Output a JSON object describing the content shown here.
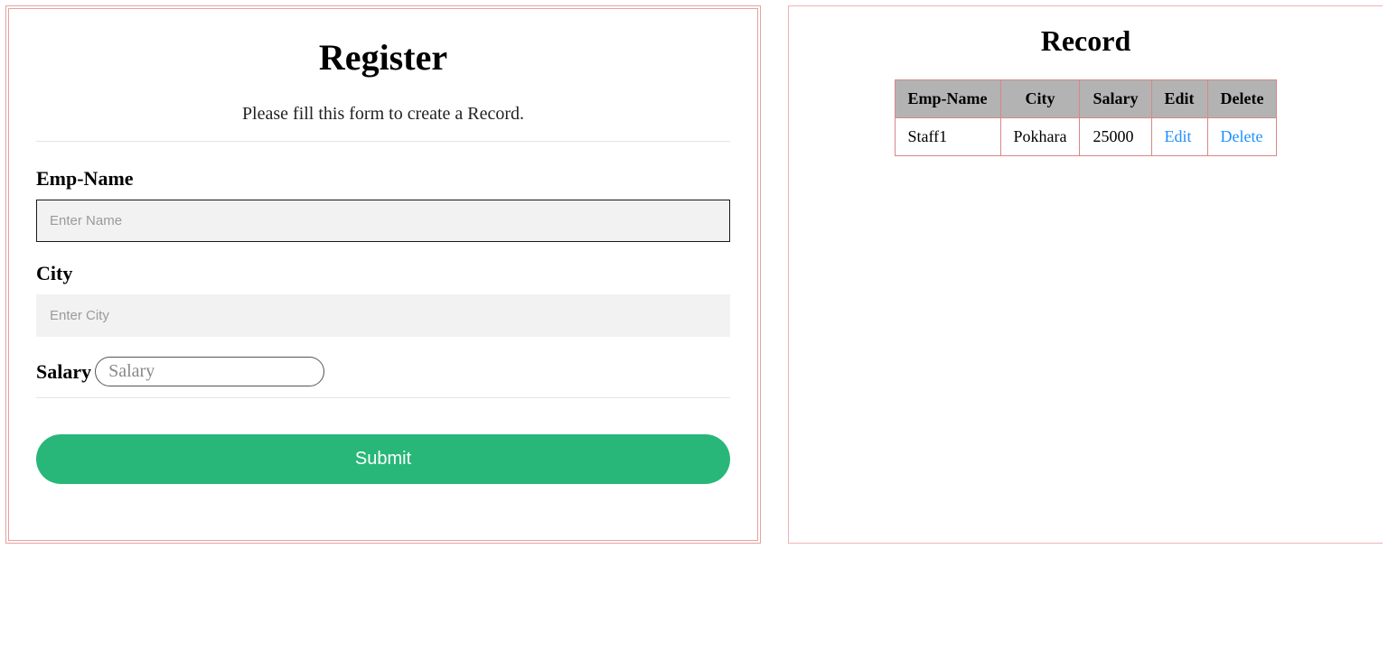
{
  "register": {
    "title": "Register",
    "subtitle": "Please fill this form to create a Record.",
    "empname_label": "Emp-Name",
    "empname_placeholder": "Enter Name",
    "empname_value": "",
    "city_label": "City",
    "city_placeholder": "Enter City",
    "city_value": "",
    "salary_label": "Salary",
    "salary_placeholder": "Salary",
    "salary_value": "",
    "submit_label": "Submit"
  },
  "record": {
    "title": "Record",
    "headers": {
      "empname": "Emp-Name",
      "city": "City",
      "salary": "Salary",
      "edit": "Edit",
      "delete": "Delete"
    },
    "rows": [
      {
        "empname": "Staff1",
        "city": "Pokhara",
        "salary": "25000",
        "edit_label": "Edit",
        "delete_label": "Delete"
      }
    ]
  }
}
